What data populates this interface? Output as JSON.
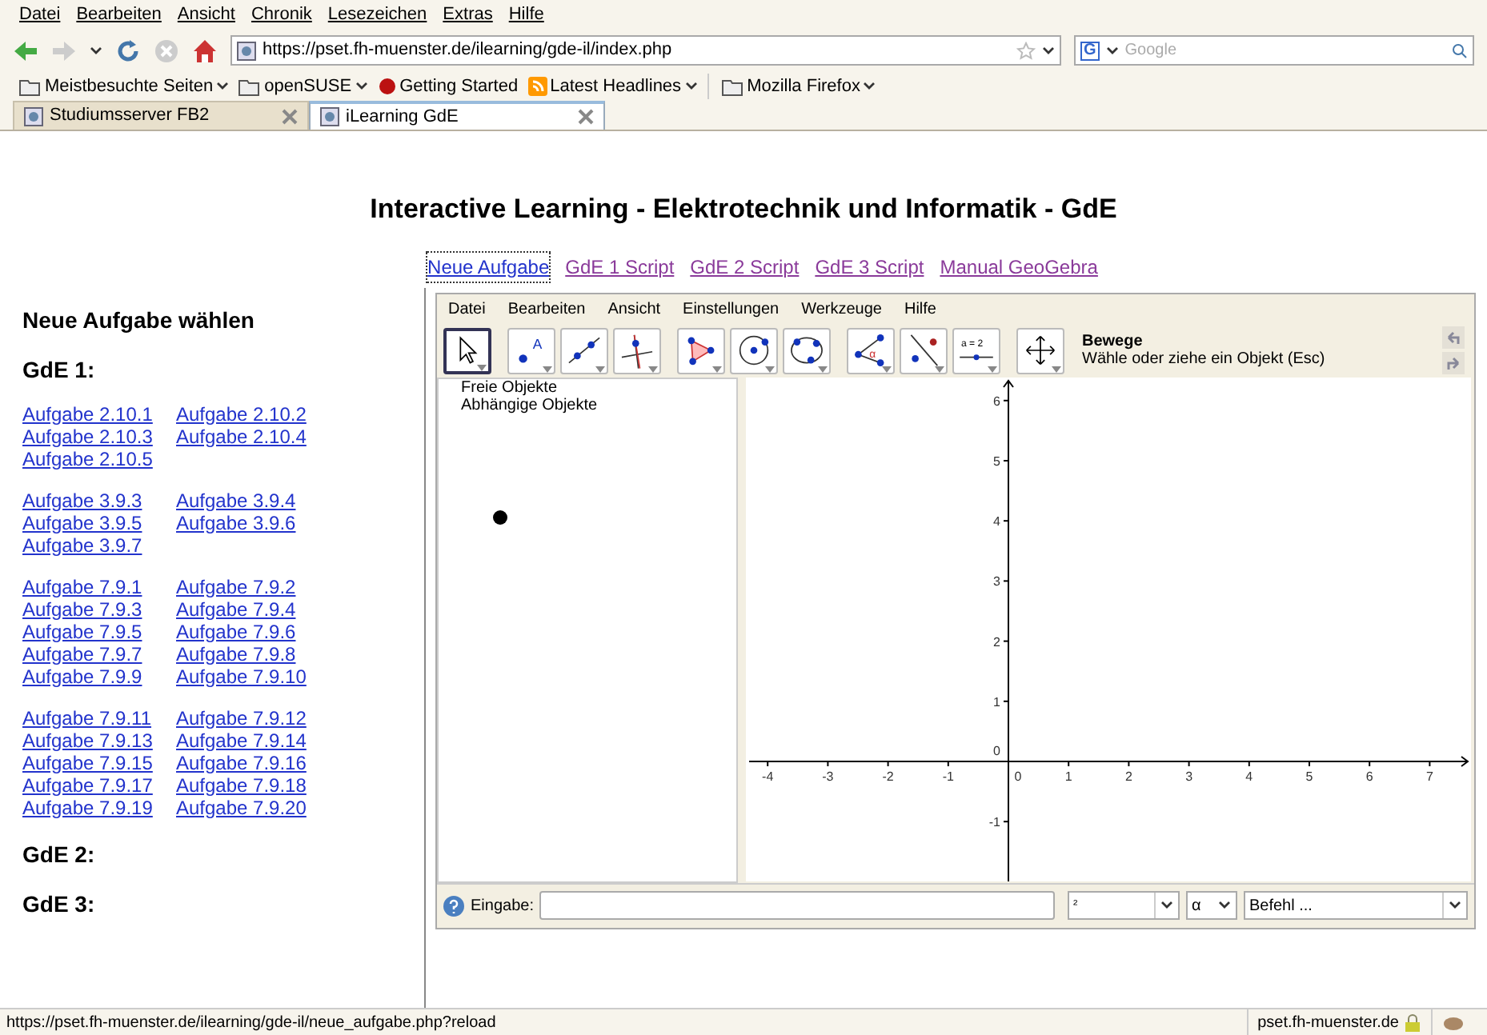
{
  "menu_bar": [
    "Datei",
    "Bearbeiten",
    "Ansicht",
    "Chronik",
    "Lesezeichen",
    "Extras",
    "Hilfe"
  ],
  "address_bar": {
    "value": "https://pset.fh-muenster.de/ilearning/gde-il/index.php"
  },
  "search_field": {
    "engine": "G",
    "placeholder": "Google"
  },
  "bookmarks": [
    {
      "label": "Meistbesuchte Seiten",
      "kind": "folder-menu"
    },
    {
      "label": "openSUSE",
      "kind": "folder-menu"
    },
    {
      "label": "Getting Started",
      "kind": "link"
    },
    {
      "label": "Latest Headlines",
      "kind": "feed-menu"
    },
    {
      "label": "Mozilla Firefox",
      "kind": "folder-menu"
    }
  ],
  "tabs": [
    {
      "label": "Studiumsserver FB2",
      "selected": false
    },
    {
      "label": "iLearning GdE",
      "selected": true
    }
  ],
  "page": {
    "title": "Interactive Learning - Elektrotechnik und Informatik - GdE",
    "nav_links": [
      {
        "label": "Neue Aufgabe",
        "visited": false,
        "focused": true
      },
      {
        "label": "GdE 1 Script",
        "visited": true,
        "focused": false
      },
      {
        "label": "GdE 2 Script",
        "visited": true,
        "focused": false
      },
      {
        "label": "GdE 3 Script",
        "visited": true,
        "focused": false
      },
      {
        "label": "Manual GeoGebra",
        "visited": true,
        "focused": false
      }
    ],
    "sidebar": {
      "heading": "Neue Aufgabe wählen",
      "sections": [
        {
          "title": "GdE 1:",
          "groups": [
            [
              "Aufgabe 2.10.1",
              "Aufgabe 2.10.2",
              "Aufgabe 2.10.3",
              "Aufgabe 2.10.4",
              "Aufgabe 2.10.5"
            ],
            [
              "Aufgabe 3.9.3",
              "Aufgabe 3.9.4",
              "Aufgabe 3.9.5",
              "Aufgabe 3.9.6",
              "Aufgabe 3.9.7"
            ],
            [
              "Aufgabe 7.9.1",
              "Aufgabe 7.9.2",
              "Aufgabe 7.9.3",
              "Aufgabe 7.9.4",
              "Aufgabe 7.9.5",
              "Aufgabe 7.9.6",
              "Aufgabe 7.9.7",
              "Aufgabe 7.9.8",
              "Aufgabe 7.9.9",
              "Aufgabe 7.9.10"
            ],
            [
              "Aufgabe 7.9.11",
              "Aufgabe 7.9.12",
              "Aufgabe 7.9.13",
              "Aufgabe 7.9.14",
              "Aufgabe 7.9.15",
              "Aufgabe 7.9.16",
              "Aufgabe 7.9.17",
              "Aufgabe 7.9.18",
              "Aufgabe 7.9.19",
              "Aufgabe 7.9.20"
            ]
          ]
        },
        {
          "title": "GdE 2:"
        },
        {
          "title": "GdE 3:"
        }
      ]
    },
    "geogebra": {
      "menu": [
        "Datei",
        "Bearbeiten",
        "Ansicht",
        "Einstellungen",
        "Werkzeuge",
        "Hilfe"
      ],
      "tools": [
        {
          "kind": "move",
          "selected": true
        },
        {
          "kind": "point",
          "label": "A",
          "selected": false
        },
        {
          "kind": "line",
          "selected": false
        },
        {
          "kind": "perpendicular",
          "selected": false
        },
        {
          "kind": "polygon",
          "selected": false
        },
        {
          "kind": "circle",
          "selected": false
        },
        {
          "kind": "conic",
          "selected": false
        },
        {
          "kind": "angle",
          "label": "α",
          "selected": false
        },
        {
          "kind": "reflect",
          "selected": false
        },
        {
          "kind": "slider",
          "label": "a = 2",
          "selected": false
        },
        {
          "kind": "move-view",
          "selected": false
        }
      ],
      "tool_name": "Bewege",
      "tool_help": "Wähle oder ziehe ein Objekt (Esc)",
      "algebra_view": [
        "Freie Objekte",
        "Abhängige Objekte"
      ],
      "graphics_view": {
        "x_ticks": [
          "-4",
          "-3",
          "-2",
          "-1",
          "0",
          "1",
          "2",
          "3",
          "4",
          "5",
          "6",
          "7"
        ],
        "y_ticks": [
          "6",
          "5",
          "4",
          "3",
          "2",
          "1",
          "0",
          "-1"
        ]
      },
      "input_label": "Eingabe:",
      "symbol_menu": "²",
      "greek_menu": "α",
      "command_menu": "Befehl ..."
    }
  },
  "status_bar": {
    "url": "https://pset.fh-muenster.de/ilearning/gde-il/neue_aufgabe.php?reload",
    "host": "pset.fh-muenster.de"
  }
}
